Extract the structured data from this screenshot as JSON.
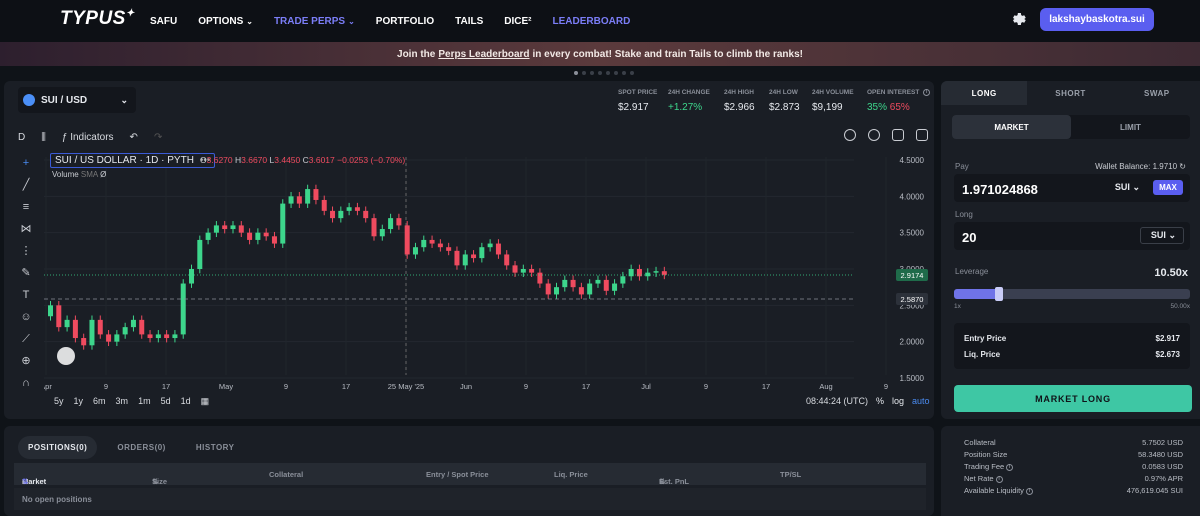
{
  "nav": {
    "logo": "TYPUS",
    "links": [
      {
        "label": "SAFU"
      },
      {
        "label": "OPTIONS",
        "chevron": "⌄"
      },
      {
        "label": "TRADE PERPS",
        "chevron": "⌄"
      },
      {
        "label": "PORTFOLIO"
      },
      {
        "label": "TAILS"
      },
      {
        "label": "DICE²"
      },
      {
        "label": "LEADERBOARD"
      }
    ],
    "wallet": "lakshaybaskotra.sui"
  },
  "banner": {
    "pre": "Join the",
    "link": "Perps Leaderboard",
    "post": "in every combat! Stake and train Tails to climb the ranks!"
  },
  "market": {
    "pair": "SUI / USD",
    "stats": [
      {
        "label": "SPOT PRICE",
        "value": "$2.917"
      },
      {
        "label": "24H CHANGE",
        "value": "+1.27%"
      },
      {
        "label": "24H HIGH",
        "value": "$2.966"
      },
      {
        "label": "24H LOW",
        "value": "$2.873"
      },
      {
        "label": "24H VOLUME",
        "value": "$9,199"
      }
    ],
    "open_interest": {
      "label": "OPEN INTEREST",
      "long": "35%",
      "short": "65%"
    }
  },
  "toolbar": {
    "interval": "D",
    "indicators": "Indicators"
  },
  "chart_header": {
    "symbol": "SUI / US DOLLAR · 1D · PYTH",
    "o_label": "O",
    "o": "3.6270",
    "h_label": "H",
    "h": "3.6670",
    "l_label": "L",
    "l": "3.4450",
    "c_label": "C",
    "c": "3.6017",
    "chg": "−0.0253 (−0.70%)",
    "volume": "Volume",
    "volume_sub": "SMA",
    "volume_val": "Ø"
  },
  "chart_data": {
    "type": "candlestick",
    "title": "SUI / US DOLLAR · 1D · PYTH",
    "y_ticks": [
      "4.5000",
      "4.0000",
      "3.5000",
      "3.0000",
      "2.5000",
      "2.0000",
      "1.5000"
    ],
    "ylim": [
      1.5,
      4.5
    ],
    "x_ticks": [
      "Apr",
      "9",
      "17",
      "May",
      "9",
      "17",
      "25 May '25",
      "Jun",
      "9",
      "17",
      "Jul",
      "9",
      "17",
      "Aug",
      "9"
    ],
    "price_labels": [
      "2.9174",
      "2.5870"
    ],
    "candles": [
      [
        2.35,
        2.5
      ],
      [
        2.5,
        2.2
      ],
      [
        2.2,
        2.3
      ],
      [
        2.3,
        2.05
      ],
      [
        2.05,
        1.95
      ],
      [
        1.95,
        2.3
      ],
      [
        2.3,
        2.1
      ],
      [
        2.1,
        2.0
      ],
      [
        2.0,
        2.1
      ],
      [
        2.1,
        2.2
      ],
      [
        2.2,
        2.3
      ],
      [
        2.3,
        2.1
      ],
      [
        2.1,
        2.05
      ],
      [
        2.05,
        2.1
      ],
      [
        2.1,
        2.05
      ],
      [
        2.05,
        2.1
      ],
      [
        2.1,
        2.8
      ],
      [
        2.8,
        3.0
      ],
      [
        3.0,
        3.4
      ],
      [
        3.4,
        3.5
      ],
      [
        3.5,
        3.6
      ],
      [
        3.6,
        3.55
      ],
      [
        3.55,
        3.6
      ],
      [
        3.6,
        3.5
      ],
      [
        3.5,
        3.4
      ],
      [
        3.4,
        3.5
      ],
      [
        3.5,
        3.45
      ],
      [
        3.45,
        3.35
      ],
      [
        3.35,
        3.9
      ],
      [
        3.9,
        4.0
      ],
      [
        4.0,
        3.9
      ],
      [
        3.9,
        4.1
      ],
      [
        4.1,
        3.95
      ],
      [
        3.95,
        3.8
      ],
      [
        3.8,
        3.7
      ],
      [
        3.7,
        3.8
      ],
      [
        3.8,
        3.85
      ],
      [
        3.85,
        3.8
      ],
      [
        3.8,
        3.7
      ],
      [
        3.7,
        3.45
      ],
      [
        3.45,
        3.55
      ],
      [
        3.55,
        3.7
      ],
      [
        3.7,
        3.6
      ],
      [
        3.6,
        3.2
      ],
      [
        3.2,
        3.3
      ],
      [
        3.3,
        3.4
      ],
      [
        3.4,
        3.35
      ],
      [
        3.35,
        3.3
      ],
      [
        3.3,
        3.25
      ],
      [
        3.25,
        3.05
      ],
      [
        3.05,
        3.2
      ],
      [
        3.2,
        3.15
      ],
      [
        3.15,
        3.3
      ],
      [
        3.3,
        3.35
      ],
      [
        3.35,
        3.2
      ],
      [
        3.2,
        3.05
      ],
      [
        3.05,
        2.95
      ],
      [
        2.95,
        3.0
      ],
      [
        3.0,
        2.95
      ],
      [
        2.95,
        2.8
      ],
      [
        2.8,
        2.65
      ],
      [
        2.65,
        2.75
      ],
      [
        2.75,
        2.85
      ],
      [
        2.85,
        2.75
      ],
      [
        2.75,
        2.65
      ],
      [
        2.65,
        2.8
      ],
      [
        2.8,
        2.85
      ],
      [
        2.85,
        2.7
      ],
      [
        2.7,
        2.8
      ],
      [
        2.8,
        2.9
      ],
      [
        2.9,
        3.0
      ],
      [
        3.0,
        2.9
      ],
      [
        2.9,
        2.95
      ],
      [
        2.95,
        2.97
      ],
      [
        2.97,
        2.92
      ]
    ]
  },
  "ranges": [
    "5y",
    "1y",
    "6m",
    "3m",
    "1m",
    "5d",
    "1d"
  ],
  "clock": "08:44:24 (UTC)",
  "scale": {
    "pct": "%",
    "log": "log",
    "auto": "auto"
  },
  "positions": {
    "tabs": [
      "POSITIONS(0)",
      "ORDERS(0)",
      "HISTORY"
    ],
    "headers": [
      "Market",
      "Size",
      "Collateral",
      "Entry / Spot Price",
      "Liq. Price",
      "Est. PnL",
      "TP/SL"
    ],
    "empty": "No open positions"
  },
  "order": {
    "tabs": [
      "LONG",
      "SHORT",
      "SWAP"
    ],
    "types": [
      "MARKET",
      "LIMIT"
    ],
    "pay_label": "Pay",
    "wallet_balance_label": "Wallet Balance:",
    "wallet_balance": "1.9710",
    "pay_value": "1.971024868",
    "pay_token": "SUI",
    "max": "MAX",
    "long_label": "Long",
    "long_value": "20",
    "long_token": "SUI",
    "leverage_label": "Leverage",
    "leverage_value": "10.50x",
    "leverage_fraction": 0.19,
    "lev_min": "1x",
    "lev_max": "50.00x",
    "entry_label": "Entry Price",
    "entry": "$2.917",
    "liq_label": "Liq. Price",
    "liq": "$2.673",
    "submit": "MARKET LONG"
  },
  "summary": [
    {
      "k": "Collateral",
      "v": "5.7502 USD",
      "info": false
    },
    {
      "k": "Position Size",
      "v": "58.3480 USD",
      "info": false
    },
    {
      "k": "Trading Fee",
      "v": "0.0583 USD",
      "info": true
    },
    {
      "k": "Net Rate",
      "v": "0.97% APR",
      "info": true
    },
    {
      "k": "Available Liquidity",
      "v": "476,619.045 SUI",
      "info": true
    }
  ],
  "colors": {
    "accent": "#5a5ef0",
    "up": "#3dd68c",
    "down": "#ef4b5f",
    "long_btn": "#3ec7a4"
  }
}
